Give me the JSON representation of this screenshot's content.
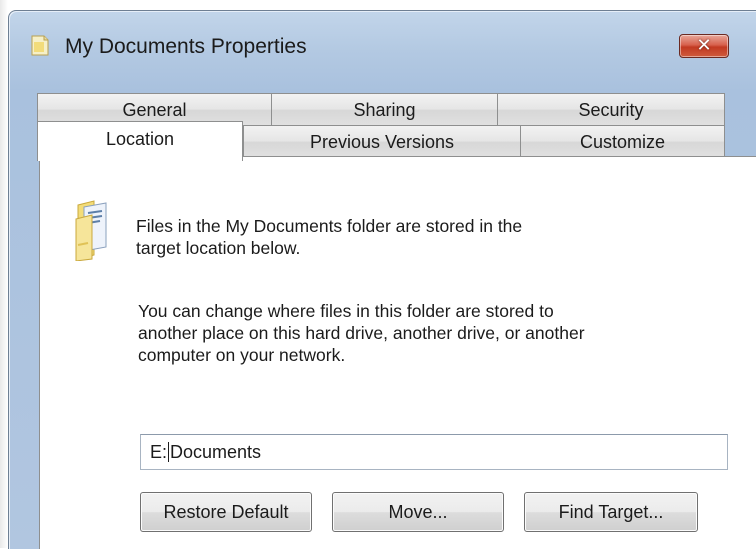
{
  "window": {
    "title": "My Documents Properties",
    "close_glyph": "✕",
    "icon": "folder-page-icon"
  },
  "tabs": {
    "row1": [
      "General",
      "Sharing",
      "Security"
    ],
    "row2": [
      "Location",
      "Previous Versions",
      "Customize"
    ],
    "active": "Location"
  },
  "location": {
    "intro_line1": "Files in the My Documents folder are stored in the",
    "intro_line2": "target location below.",
    "desc_line1": "You can change where files in this folder are stored to",
    "desc_line2": "another place on this hard drive, another drive, or another",
    "desc_line3": "computer on your network.",
    "path_before_caret": "E:",
    "path_after_caret": "Documents",
    "buttons": {
      "restore": "Restore Default",
      "move": "Move...",
      "find": "Find Target..."
    }
  },
  "colors": {
    "titlebar": "#b3c9e2",
    "close_button": "#c8432b",
    "tab_face": "#e5e5e5",
    "panel": "#ffffff"
  }
}
